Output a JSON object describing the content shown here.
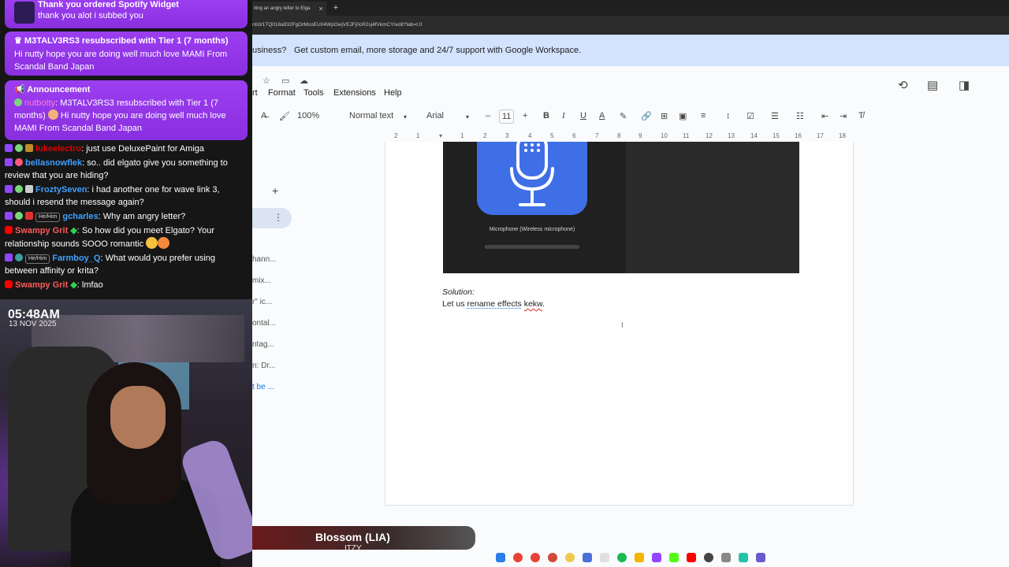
{
  "browser": {
    "tab_title": "iting an angry letter to Elga",
    "tab_close": "×",
    "new_tab": "+",
    "url": "nt/d/1TQ018a932FgOrMcoEU04WpOwjVEJFj0cR2sj4fVkmCY/edit?tab=t.0"
  },
  "docs": {
    "promo_bold": "usiness?",
    "promo_text": "Get custom email, more storage and 24/7 support with Google Workspace.",
    "menu": [
      "rt",
      "Format",
      "Tools",
      "Extensions",
      "Help"
    ],
    "toolbar": {
      "zoom": "100%",
      "style": "Normal text",
      "font": "Arial",
      "font_size": "11",
      "minus": "–",
      "plus": "+",
      "bold": "B",
      "italic": "I",
      "underline": "U",
      "text_color": "A"
    },
    "ruler": [
      "2",
      "1",
      "1",
      "2",
      "3",
      "4",
      "5",
      "6",
      "7",
      "8",
      "9",
      "10",
      "11",
      "12",
      "13",
      "14",
      "15",
      "16",
      "17",
      "18"
    ],
    "outline": [
      "hann...",
      "mix...",
      "r\" ic...",
      "ontal...",
      "ntag...",
      "n: Dr...",
      "t be ..."
    ],
    "image_caption": "Microphone (Wireless microphone)",
    "solution_label": "Solution:",
    "body_pre": "Let us ",
    "body_rename": "rename effects",
    "body_space": " ",
    "body_kekw": "kekw",
    "body_end": "."
  },
  "overlay": {
    "alert1": {
      "title": "Thank you ordered Spotify Widget",
      "message": "thank you alot i subbed you"
    },
    "alert2": {
      "title": "M3TALV3RS3 resubscribed with Tier 1 (7 months)",
      "message": "Hi nutty hope you are doing well much love MAMI From Scandal Band Japan"
    },
    "alert3": {
      "title": "Announcement",
      "user": "nutbotty",
      "message_a": ": M3TALV3RS3 resubscribed with Tier 1 (7 months)",
      "message_b": " Hi nutty hope you are doing well much love MAMI From Scandal Band Japan"
    },
    "chat": [
      {
        "user": "lukeelectro",
        "text": ": just use DeluxePaint for Amiga"
      },
      {
        "user": "bellasnowflek",
        "text": ": so.. did elgato give you something to review that you are hiding?"
      },
      {
        "user": "FroztySeven",
        "text": ": i had another one for wave link 3, should i resend the message again?"
      },
      {
        "pronoun": "He/Him",
        "user": "gcharles",
        "text": ": Why am angry letter?"
      },
      {
        "user": "Swampy Grit",
        "text": ": So how did you meet Elgato? Your relationship sounds SOOO romantic"
      },
      {
        "pronoun": "He/Him",
        "user": "Farmboy_Q",
        "text": ": What would you prefer using between affinity or krita?"
      },
      {
        "user": "Swampy Grit",
        "text": ": lmfao"
      }
    ],
    "time": "05:48AM",
    "date": "13 NOV 2025"
  },
  "now_playing": {
    "title": "Blossom (LIA)",
    "artist": "ITZY"
  },
  "colors": {
    "accent": "#9146ff",
    "docs_blue": "#3f6fe6",
    "promo_bg": "#d3e3fd"
  }
}
